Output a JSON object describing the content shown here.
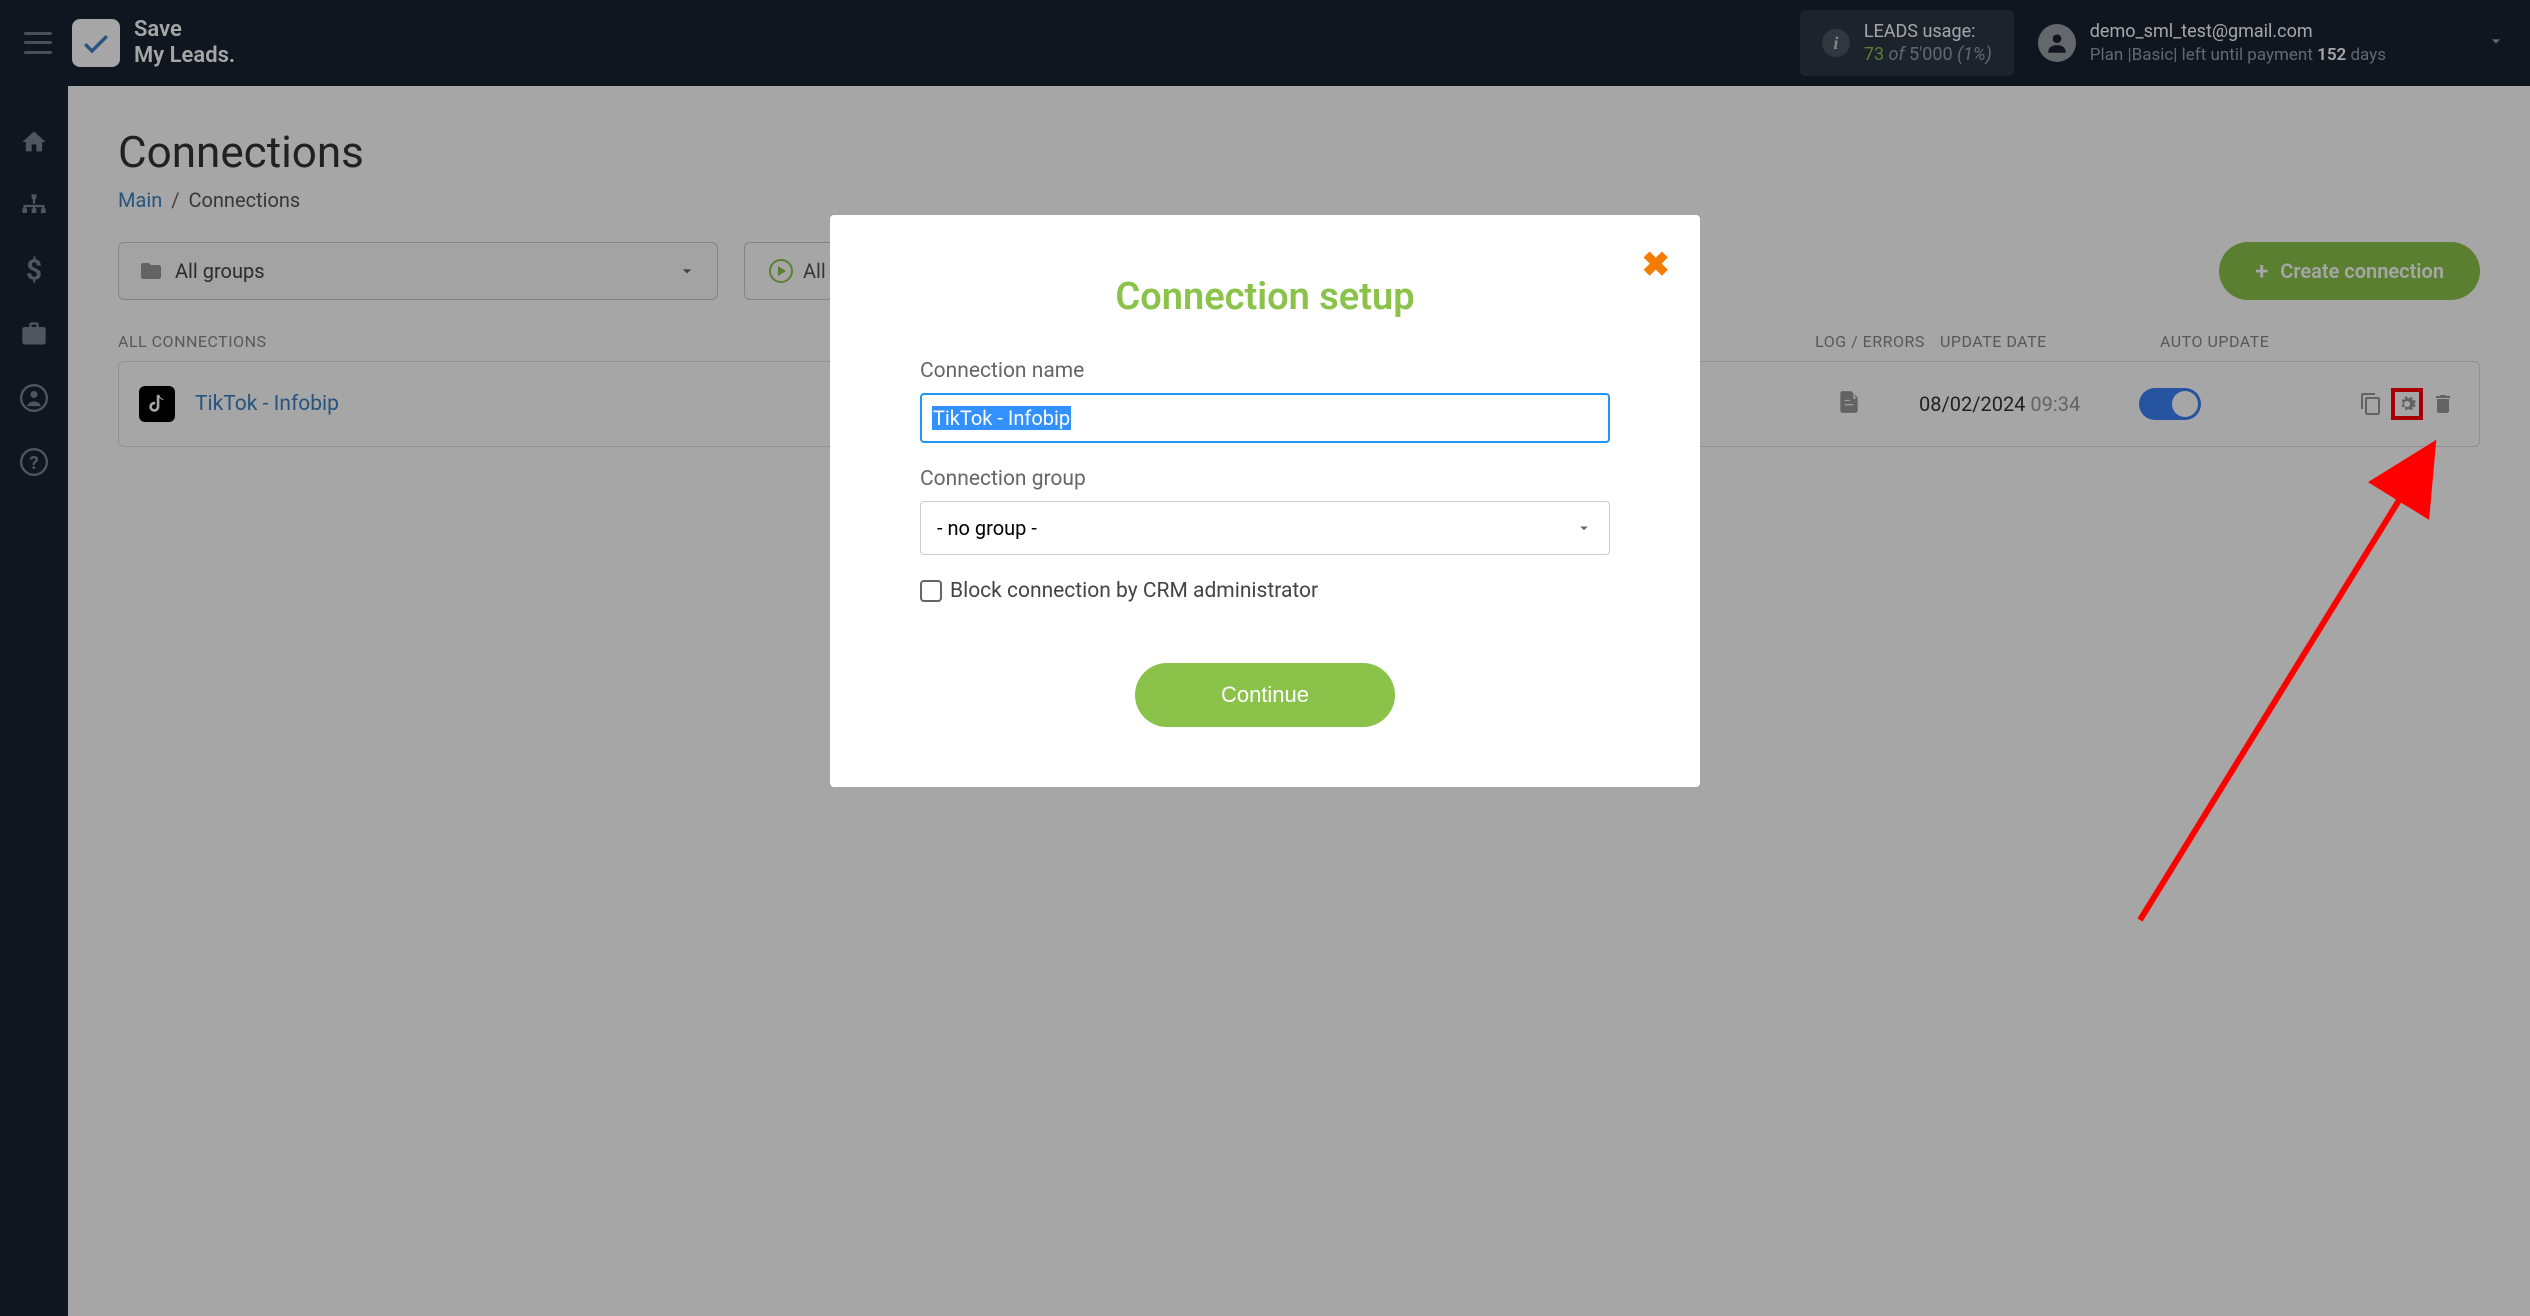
{
  "header": {
    "logo_line1": "Save",
    "logo_line2": "My Leads.",
    "usage_label": "LEADS usage:",
    "usage_used": "73",
    "usage_of": "of",
    "usage_total": "5'000",
    "usage_percent": "(1%)",
    "user_email": "demo_sml_test@gmail.com",
    "user_plan_prefix": "Plan |Basic| left until payment ",
    "user_days": "152",
    "user_days_suffix": " days"
  },
  "page": {
    "title": "Connections",
    "breadcrumb_main": "Main",
    "breadcrumb_sep": "/",
    "breadcrumb_current": "Connections",
    "groups_select": "All groups",
    "run_all_label": "All",
    "create_btn": "Create connection",
    "col_all": "ALL CONNECTIONS",
    "col_log": "LOG / ERRORS",
    "col_date": "UPDATE DATE",
    "col_auto": "AUTO UPDATE"
  },
  "row": {
    "name": "TikTok - Infobip",
    "date": "08/02/2024",
    "time": "09:34"
  },
  "modal": {
    "title": "Connection setup",
    "name_label": "Connection name",
    "name_value": "TikTok - Infobip",
    "group_label": "Connection group",
    "group_value": "- no group -",
    "block_label": "Block connection by CRM administrator",
    "continue": "Continue"
  }
}
